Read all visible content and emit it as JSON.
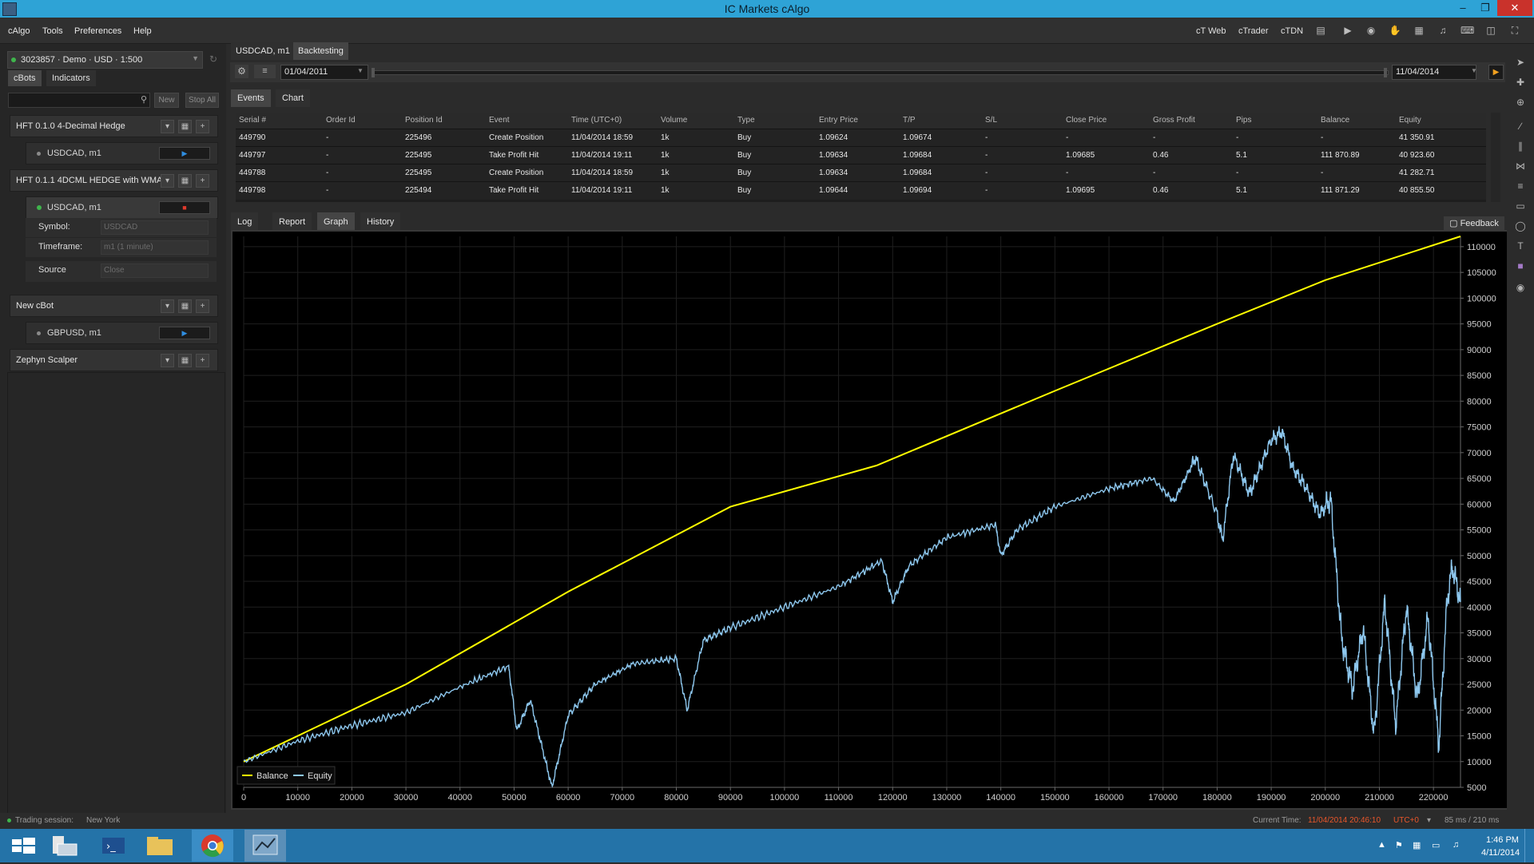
{
  "window": {
    "title": "IC Markets cAlgo"
  },
  "menu": {
    "items": [
      "cAlgo",
      "Tools",
      "Preferences",
      "Help"
    ],
    "right": [
      "cT Web",
      "cTrader",
      "cTDN"
    ]
  },
  "account": {
    "label": "3023857 · Demo · USD · 1:500"
  },
  "left_tabs": [
    "cBots",
    "Indicators"
  ],
  "left_buttons": {
    "new": "New",
    "stop_all": "Stop All"
  },
  "bots": [
    {
      "name": "HFT 0.1.0 4-Decimal Hedge",
      "instance": "USDCAD, m1",
      "state": "play"
    },
    {
      "name": "HFT 0.1.1 4DCML HEDGE with WMA",
      "instance": "USDCAD, m1",
      "state": "stop"
    },
    {
      "name": "New cBot",
      "instance": "GBPUSD, m1",
      "state": "play"
    },
    {
      "name": "Zephyn Scalper"
    }
  ],
  "params": [
    {
      "label": "Symbol:",
      "value": "USDCAD"
    },
    {
      "label": "Timeframe:",
      "value": "m1 (1 minute)"
    },
    {
      "label": "Source",
      "value": "Close"
    }
  ],
  "doc_tabs": [
    "USDCAD, m1",
    "Backtesting"
  ],
  "backtest": {
    "from": "01/04/2011",
    "to": "11/04/2014"
  },
  "top_tabs": [
    "Events",
    "Chart"
  ],
  "events": {
    "columns": [
      "Serial #",
      "Order Id",
      "Position Id",
      "Event",
      "Time (UTC+0)",
      "Volume",
      "Type",
      "Entry Price",
      "T/P",
      "S/L",
      "Close Price",
      "Gross Profit",
      "Pips",
      "Balance",
      "Equity"
    ],
    "rows": [
      [
        "449790",
        "-",
        "225496",
        "Create Position",
        "11/04/2014 18:59",
        "1k",
        "Buy",
        "1.09624",
        "1.09674",
        "-",
        "-",
        "-",
        "-",
        "-",
        "41 350.91"
      ],
      [
        "449797",
        "-",
        "225495",
        "Take Profit Hit",
        "11/04/2014 19:11",
        "1k",
        "Buy",
        "1.09634",
        "1.09684",
        "-",
        "1.09685",
        "0.46",
        "5.1",
        "111 870.89",
        "40 923.60"
      ],
      [
        "449788",
        "-",
        "225495",
        "Create Position",
        "11/04/2014 18:59",
        "1k",
        "Buy",
        "1.09634",
        "1.09684",
        "-",
        "-",
        "-",
        "-",
        "-",
        "41 282.71"
      ],
      [
        "449798",
        "-",
        "225494",
        "Take Profit Hit",
        "11/04/2014 19:11",
        "1k",
        "Buy",
        "1.09644",
        "1.09694",
        "-",
        "1.09695",
        "0.46",
        "5.1",
        "111 871.29",
        "40 855.50"
      ]
    ]
  },
  "bottom_tabs": [
    "Log",
    "Report",
    "Graph",
    "History"
  ],
  "feedback_label": "Feedback",
  "chart_data": {
    "type": "line",
    "xlim": [
      0,
      225000
    ],
    "ylim": [
      5000,
      112000
    ],
    "x_ticks": [
      0,
      10000,
      20000,
      30000,
      40000,
      50000,
      60000,
      70000,
      80000,
      90000,
      100000,
      110000,
      120000,
      130000,
      140000,
      150000,
      160000,
      170000,
      180000,
      190000,
      200000,
      210000,
      220000
    ],
    "y_ticks": [
      5000,
      10000,
      15000,
      20000,
      25000,
      30000,
      35000,
      40000,
      45000,
      50000,
      55000,
      60000,
      65000,
      70000,
      75000,
      80000,
      85000,
      90000,
      95000,
      100000,
      105000,
      110000
    ],
    "legend_position": "bottom-left",
    "series": [
      {
        "name": "Balance",
        "color": "#ffff00",
        "x": [
          0,
          30000,
          60000,
          90000,
          117000,
          150000,
          180000,
          200000,
          225000
        ],
        "values": [
          10000,
          25000,
          43000,
          59500,
          67500,
          82000,
          95000,
          103500,
          112000
        ]
      },
      {
        "name": "Equity",
        "color": "#8ec8ef",
        "x": [
          0,
          10000,
          20000,
          30000,
          40000,
          49000,
          50500,
          53000,
          57000,
          60000,
          65000,
          72000,
          80000,
          82000,
          85000,
          90000,
          100000,
          110000,
          118000,
          120000,
          123000,
          130000,
          139000,
          140000,
          143000,
          150000,
          160000,
          168000,
          172000,
          176000,
          180000,
          181000,
          183000,
          186000,
          190000,
          192000,
          194000,
          196000,
          199000,
          201000,
          203000,
          205000,
          207000,
          209000,
          211000,
          213000,
          215000,
          217000,
          219000,
          221000,
          222500,
          223500,
          225000
        ],
        "values": [
          10000,
          14000,
          17000,
          19500,
          24500,
          28500,
          16000,
          22000,
          5000,
          19000,
          25000,
          29000,
          30000,
          20000,
          33500,
          36000,
          40000,
          44000,
          49000,
          41000,
          48000,
          53500,
          56000,
          50000,
          55000,
          59500,
          63000,
          65000,
          60500,
          69000,
          58000,
          53000,
          69500,
          62000,
          72500,
          74000,
          67000,
          64000,
          58000,
          61000,
          34000,
          24000,
          36000,
          15000,
          41000,
          17000,
          40000,
          22000,
          38000,
          13000,
          41000,
          48000,
          41000
        ]
      }
    ]
  },
  "status": {
    "session_label": "Trading session:",
    "session_value": "New York",
    "current_time_label": "Current Time:",
    "current_time": "11/04/2014 20:46:10",
    "tz": "UTC+0",
    "latency": "85 ms / 210 ms"
  },
  "taskbar": {
    "time": "1:46 PM",
    "date": "4/11/2014"
  }
}
